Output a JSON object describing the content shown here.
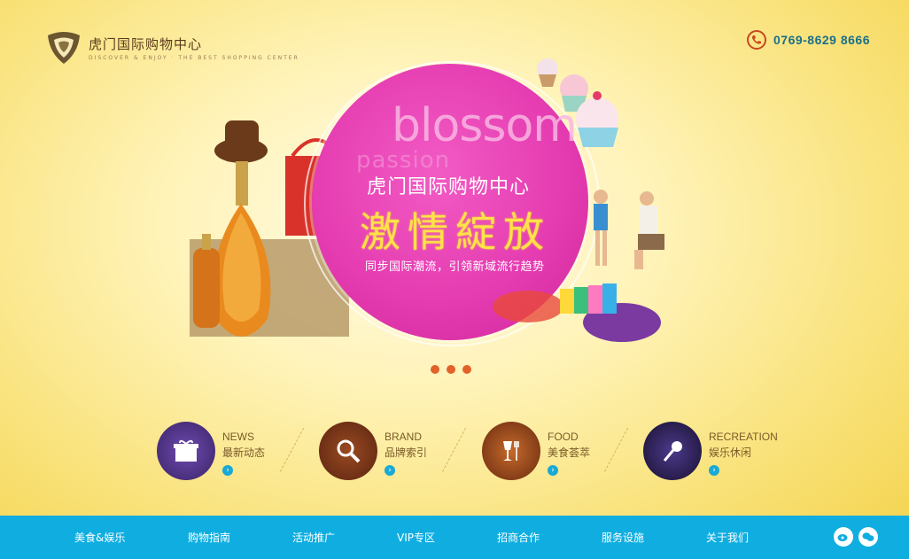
{
  "brand": {
    "title": "虎门国际购物中心",
    "tagline": "DISCOVER & ENJOY · THE BEST SHOPPING CENTER"
  },
  "contact": {
    "phone": "0769-8629 8666",
    "icon": "phone-icon"
  },
  "hero": {
    "bg_word": "blossom",
    "bg_word2": "passion",
    "title": "虎门国际购物中心",
    "slogan": "激情綻放",
    "subtitle": "同步国际潮流，引领新域流行趋势",
    "accent_color": "#e43ab0",
    "slogan_color": "#ffe14a"
  },
  "carousel": {
    "dots": [
      "1",
      "2",
      "3"
    ],
    "dot_color": "#e2622a"
  },
  "features": [
    {
      "en": "NEWS",
      "cn": "最新动态",
      "icon": "gift-icon",
      "color": "#4b2f7a"
    },
    {
      "en": "BRAND",
      "cn": "品牌索引",
      "icon": "search-icon",
      "color": "#6b2f1a"
    },
    {
      "en": "FOOD",
      "cn": "美食荟萃",
      "icon": "cutlery-icon",
      "color": "#8a3a12"
    },
    {
      "en": "RECREATION",
      "cn": "娱乐休闲",
      "icon": "microphone-icon",
      "color": "#2a1a4a"
    }
  ],
  "nav": {
    "bg_color": "#10aee0",
    "items": [
      "美食&娱乐",
      "购物指南",
      "活动推广",
      "VIP专区",
      "招商合作",
      "服务设施",
      "关于我们"
    ],
    "social": [
      "weibo-icon",
      "wechat-icon"
    ]
  }
}
